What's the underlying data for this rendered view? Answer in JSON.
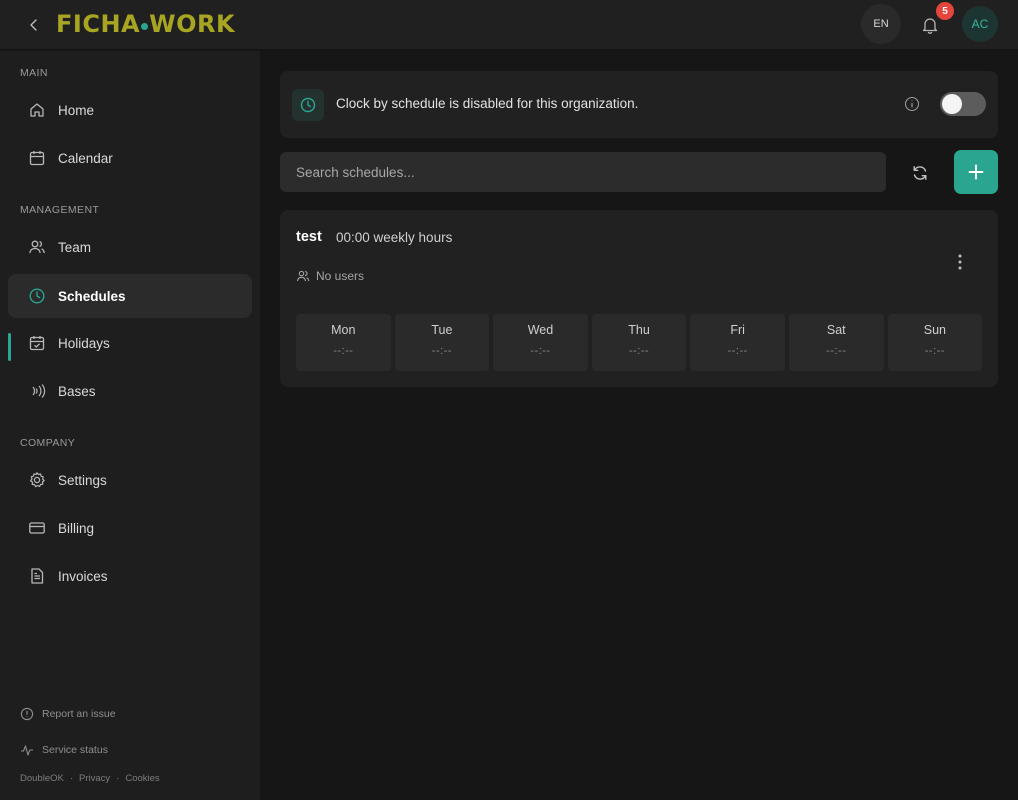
{
  "app": {
    "logo_left": "FICHA",
    "logo_right": "WORK",
    "accent_color": "#2aa590",
    "logo_color": "#a7a521"
  },
  "header": {
    "language": "EN",
    "notifications_count": "5",
    "avatar_initials": "AC"
  },
  "sidebar": {
    "sections": {
      "main": "MAIN",
      "management": "MANAGEMENT",
      "company": "COMPANY"
    },
    "items": [
      {
        "label": "Home",
        "icon": "home-icon"
      },
      {
        "label": "Calendar",
        "icon": "calendar-icon"
      },
      {
        "label": "Team",
        "icon": "team-icon"
      },
      {
        "label": "Schedules",
        "icon": "clock-icon",
        "active": true
      },
      {
        "label": "Holidays",
        "icon": "calendar-check-icon"
      },
      {
        "label": "Bases",
        "icon": "signal-icon"
      },
      {
        "label": "Settings",
        "icon": "gear-icon"
      },
      {
        "label": "Billing",
        "icon": "credit-card-icon"
      },
      {
        "label": "Invoices",
        "icon": "document-icon"
      }
    ],
    "footer": {
      "report_issue": "Report an issue",
      "service_status": "Service status",
      "brand": "DoubleOK",
      "privacy": "Privacy",
      "cookies": "Cookies",
      "separator": "·"
    }
  },
  "banner": {
    "text": "Clock by schedule is disabled for this organization.",
    "toggle_on": false
  },
  "search": {
    "placeholder": "Search schedules..."
  },
  "schedules": [
    {
      "name": "test",
      "hours": "00:00 weekly hours",
      "users": "No users",
      "days": [
        {
          "day": "Mon",
          "time": "--:--"
        },
        {
          "day": "Tue",
          "time": "--:--"
        },
        {
          "day": "Wed",
          "time": "--:--"
        },
        {
          "day": "Thu",
          "time": "--:--"
        },
        {
          "day": "Fri",
          "time": "--:--"
        },
        {
          "day": "Sat",
          "time": "--:--"
        },
        {
          "day": "Sun",
          "time": "--:--"
        }
      ]
    }
  ]
}
